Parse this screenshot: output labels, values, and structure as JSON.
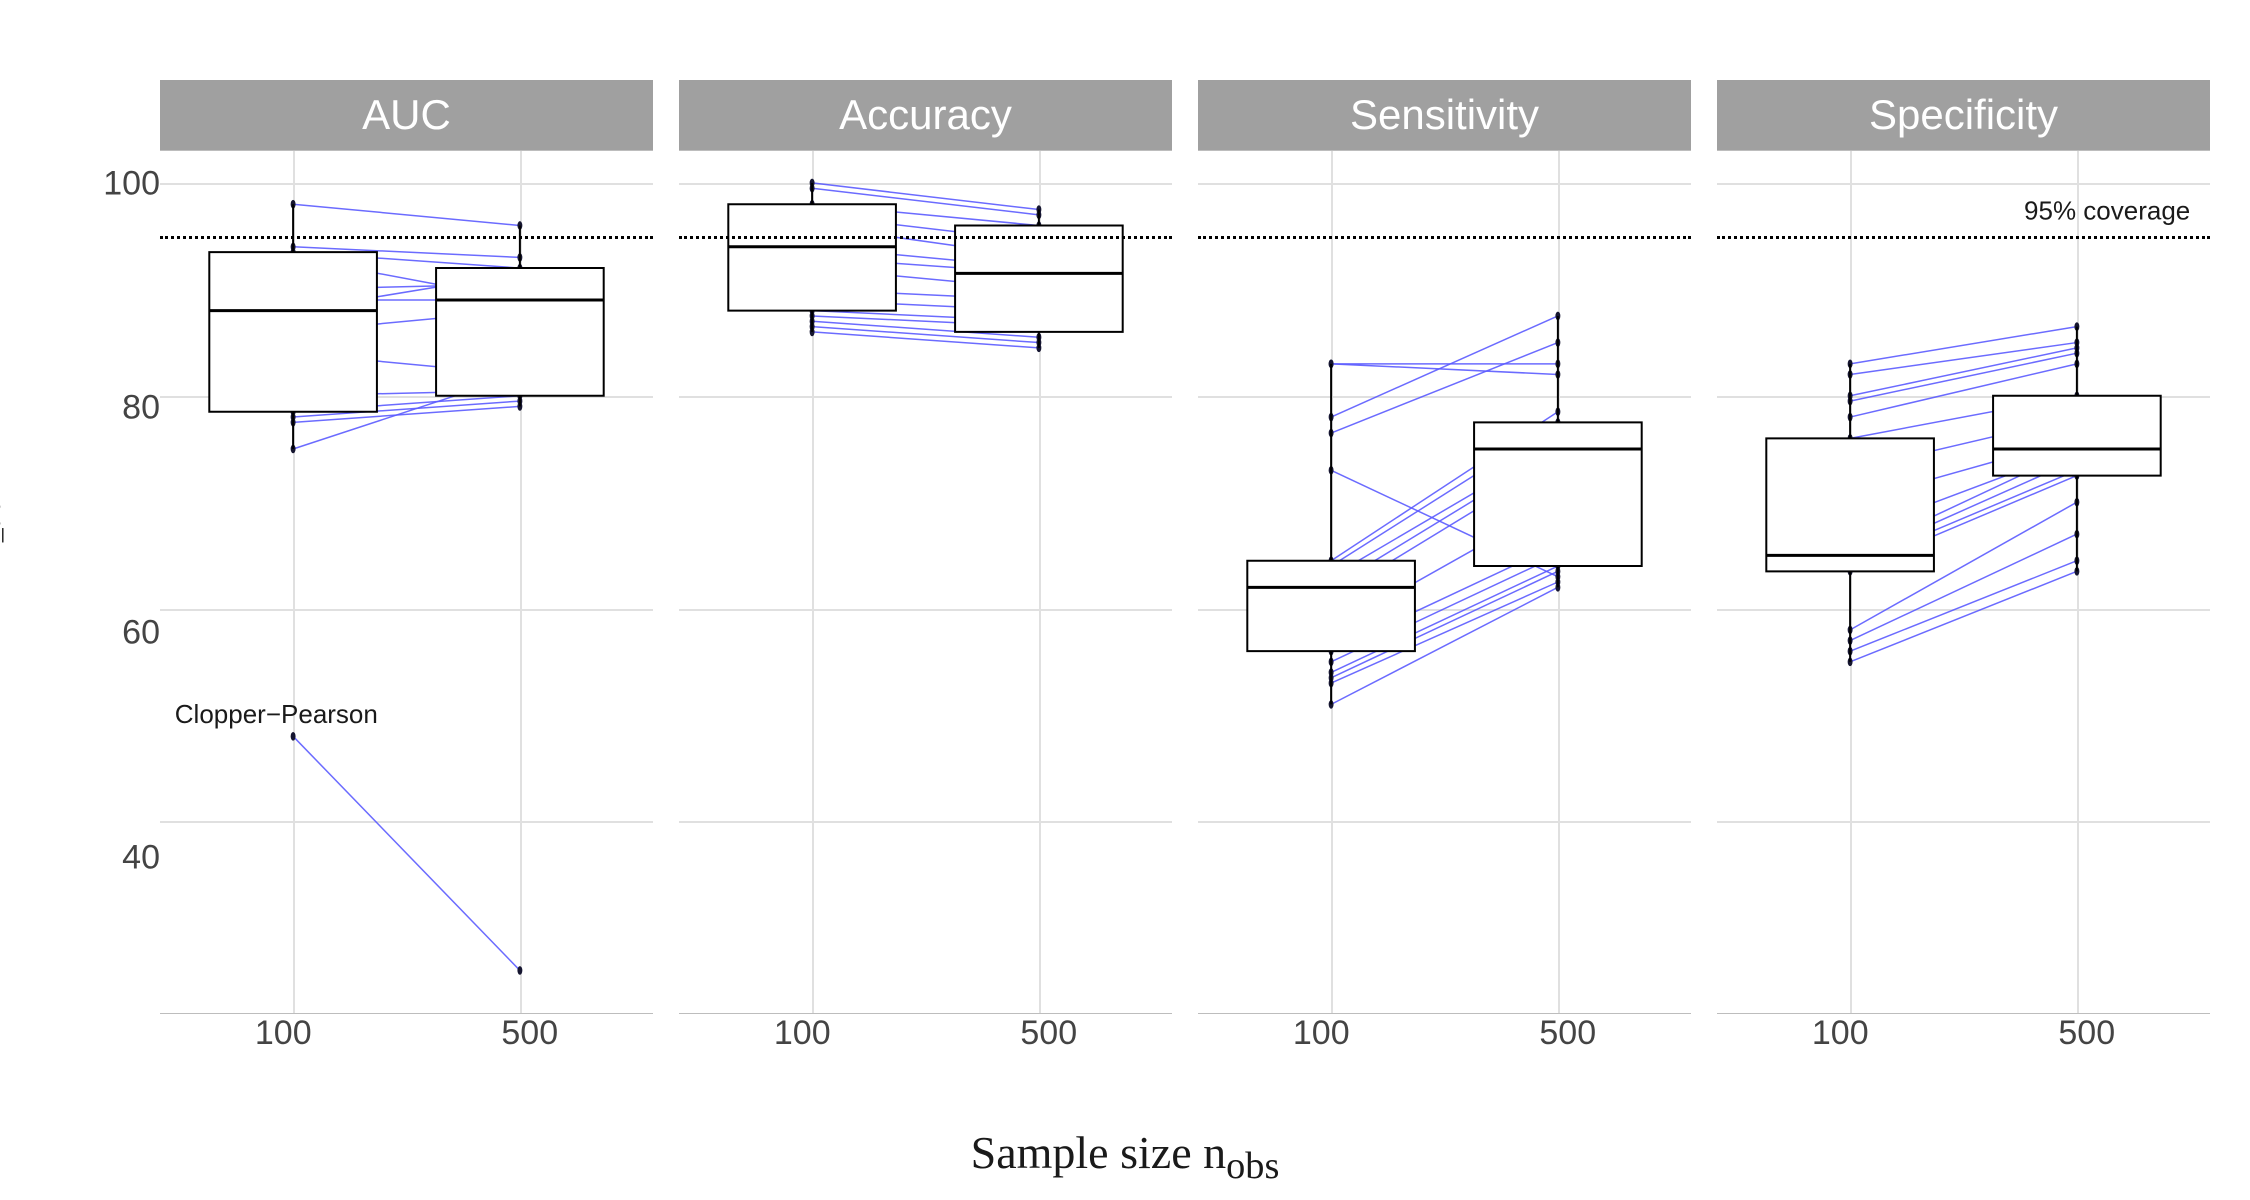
{
  "xlabel": "Sample size n",
  "xlabel_sub": "obs",
  "ylabel_pre": "Coverage ",
  "ylabel_sym": "ψ̃",
  "ylabel_sub": "n_train",
  "ylabel_post": "  %",
  "y_ticks": [
    40,
    60,
    80,
    100
  ],
  "x_ticks": [
    "100",
    "500"
  ],
  "reference_line": 95,
  "reference_label": "95% coverage",
  "outlier_label": "Clopper−Pearson",
  "chart_data": {
    "type": "box",
    "facets": [
      "AUC",
      "Accuracy",
      "Sensitivity",
      "Specificity"
    ],
    "x_levels": [
      "100",
      "500"
    ],
    "ylim": [
      22,
      103
    ],
    "reference": 95,
    "panels": [
      {
        "facet": "AUC",
        "boxes": {
          "100": {
            "q1": 78.5,
            "median": 88,
            "q3": 93.5,
            "wlo": 75,
            "whi": 98
          },
          "500": {
            "q1": 80,
            "median": 89,
            "q3": 92,
            "wlo": 79,
            "whi": 96
          }
        },
        "pairs": [
          [
            98,
            96
          ],
          [
            94,
            93
          ],
          [
            93.5,
            92
          ],
          [
            93,
            89
          ],
          [
            90,
            90.5
          ],
          [
            89,
            89
          ],
          [
            88,
            91.5
          ],
          [
            86,
            88
          ],
          [
            84,
            82
          ],
          [
            80,
            80.5
          ],
          [
            78.5,
            80
          ],
          [
            78,
            79.5
          ],
          [
            77.5,
            79
          ],
          [
            75,
            82
          ],
          [
            48,
            26
          ]
        ],
        "outlier_annotation": {
          "x_level": "100",
          "y": 48,
          "label_key": "outlier_label"
        }
      },
      {
        "facet": "Accuracy",
        "boxes": {
          "100": {
            "q1": 88,
            "median": 94,
            "q3": 98,
            "wlo": 86,
            "whi": 100
          },
          "500": {
            "q1": 86,
            "median": 91.5,
            "q3": 96,
            "wlo": 84.5,
            "whi": 97.5
          }
        },
        "pairs": [
          [
            100,
            97.5
          ],
          [
            99.5,
            97
          ],
          [
            98,
            96
          ],
          [
            97,
            94.5
          ],
          [
            96,
            93
          ],
          [
            94,
            92
          ],
          [
            93,
            91.5
          ],
          [
            92,
            90
          ],
          [
            90,
            89
          ],
          [
            89,
            88
          ],
          [
            88,
            87
          ],
          [
            87.5,
            86.5
          ],
          [
            87,
            85.5
          ],
          [
            86.5,
            85
          ],
          [
            86,
            84.5
          ]
        ]
      },
      {
        "facet": "Sensitivity",
        "boxes": {
          "100": {
            "q1": 56,
            "median": 62,
            "q3": 64.5,
            "wlo": 51,
            "whi": 83
          },
          "500": {
            "q1": 64,
            "median": 75,
            "q3": 77.5,
            "wlo": 62,
            "whi": 87.5
          }
        },
        "pairs": [
          [
            83,
            82
          ],
          [
            83,
            83
          ],
          [
            78,
            87.5
          ],
          [
            76.5,
            85
          ],
          [
            73,
            63
          ],
          [
            64.5,
            78.5
          ],
          [
            64,
            77.5
          ],
          [
            63,
            75.5
          ],
          [
            62,
            75
          ],
          [
            61,
            74
          ],
          [
            58,
            70
          ],
          [
            56,
            66
          ],
          [
            55,
            65
          ],
          [
            54,
            64
          ],
          [
            53.5,
            63.5
          ],
          [
            53,
            62.5
          ],
          [
            51,
            62
          ]
        ]
      },
      {
        "facet": "Specificity",
        "boxes": {
          "100": {
            "q1": 63.5,
            "median": 65,
            "q3": 76,
            "wlo": 55,
            "whi": 83
          },
          "500": {
            "q1": 72.5,
            "median": 75,
            "q3": 80,
            "wlo": 63.5,
            "whi": 86.5
          }
        },
        "pairs": [
          [
            83,
            86.5
          ],
          [
            82,
            85
          ],
          [
            80,
            84.5
          ],
          [
            79.5,
            84
          ],
          [
            78,
            83
          ],
          [
            76,
            80
          ],
          [
            73,
            78
          ],
          [
            70,
            76
          ],
          [
            67,
            75
          ],
          [
            65,
            75
          ],
          [
            64.5,
            74
          ],
          [
            64,
            73
          ],
          [
            63.5,
            72.5
          ],
          [
            58,
            70
          ],
          [
            57,
            67
          ],
          [
            56,
            64.5
          ],
          [
            55,
            63.5
          ]
        ],
        "reference_annotation": {
          "label_key": "reference_label"
        }
      }
    ]
  }
}
